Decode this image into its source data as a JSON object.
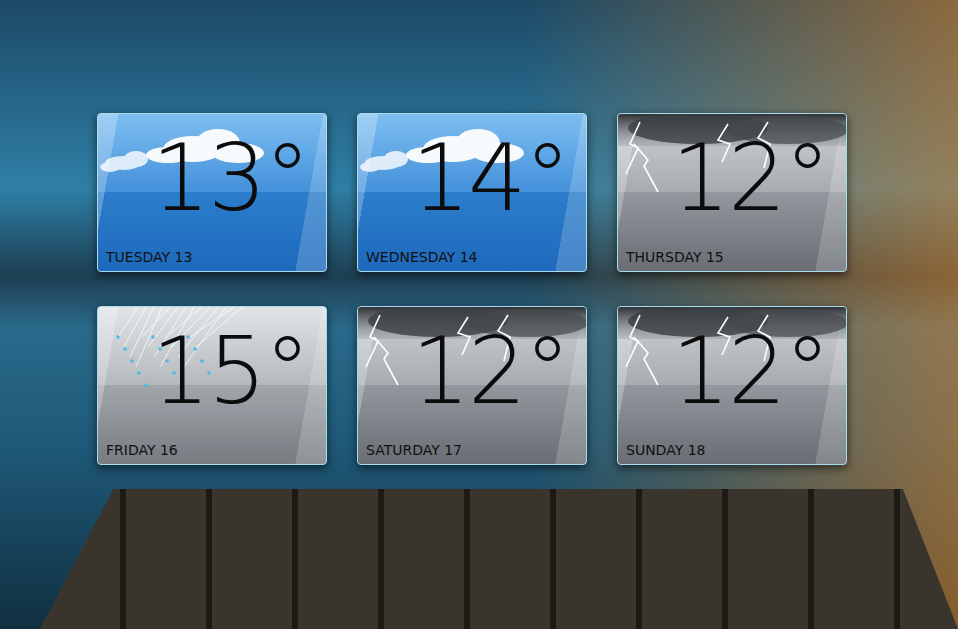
{
  "forecast": [
    {
      "day": "TUESDAY 13",
      "temperature": "13°",
      "kind": "clouds"
    },
    {
      "day": "WEDNESDAY 14",
      "temperature": "14°",
      "kind": "clouds"
    },
    {
      "day": "THURSDAY 15",
      "temperature": "12°",
      "kind": "storm"
    },
    {
      "day": "FRIDAY 16",
      "temperature": "15°",
      "kind": "rain"
    },
    {
      "day": "SATURDAY 17",
      "temperature": "12°",
      "kind": "storm"
    },
    {
      "day": "SUNDAY 18",
      "temperature": "12°",
      "kind": "storm"
    }
  ]
}
